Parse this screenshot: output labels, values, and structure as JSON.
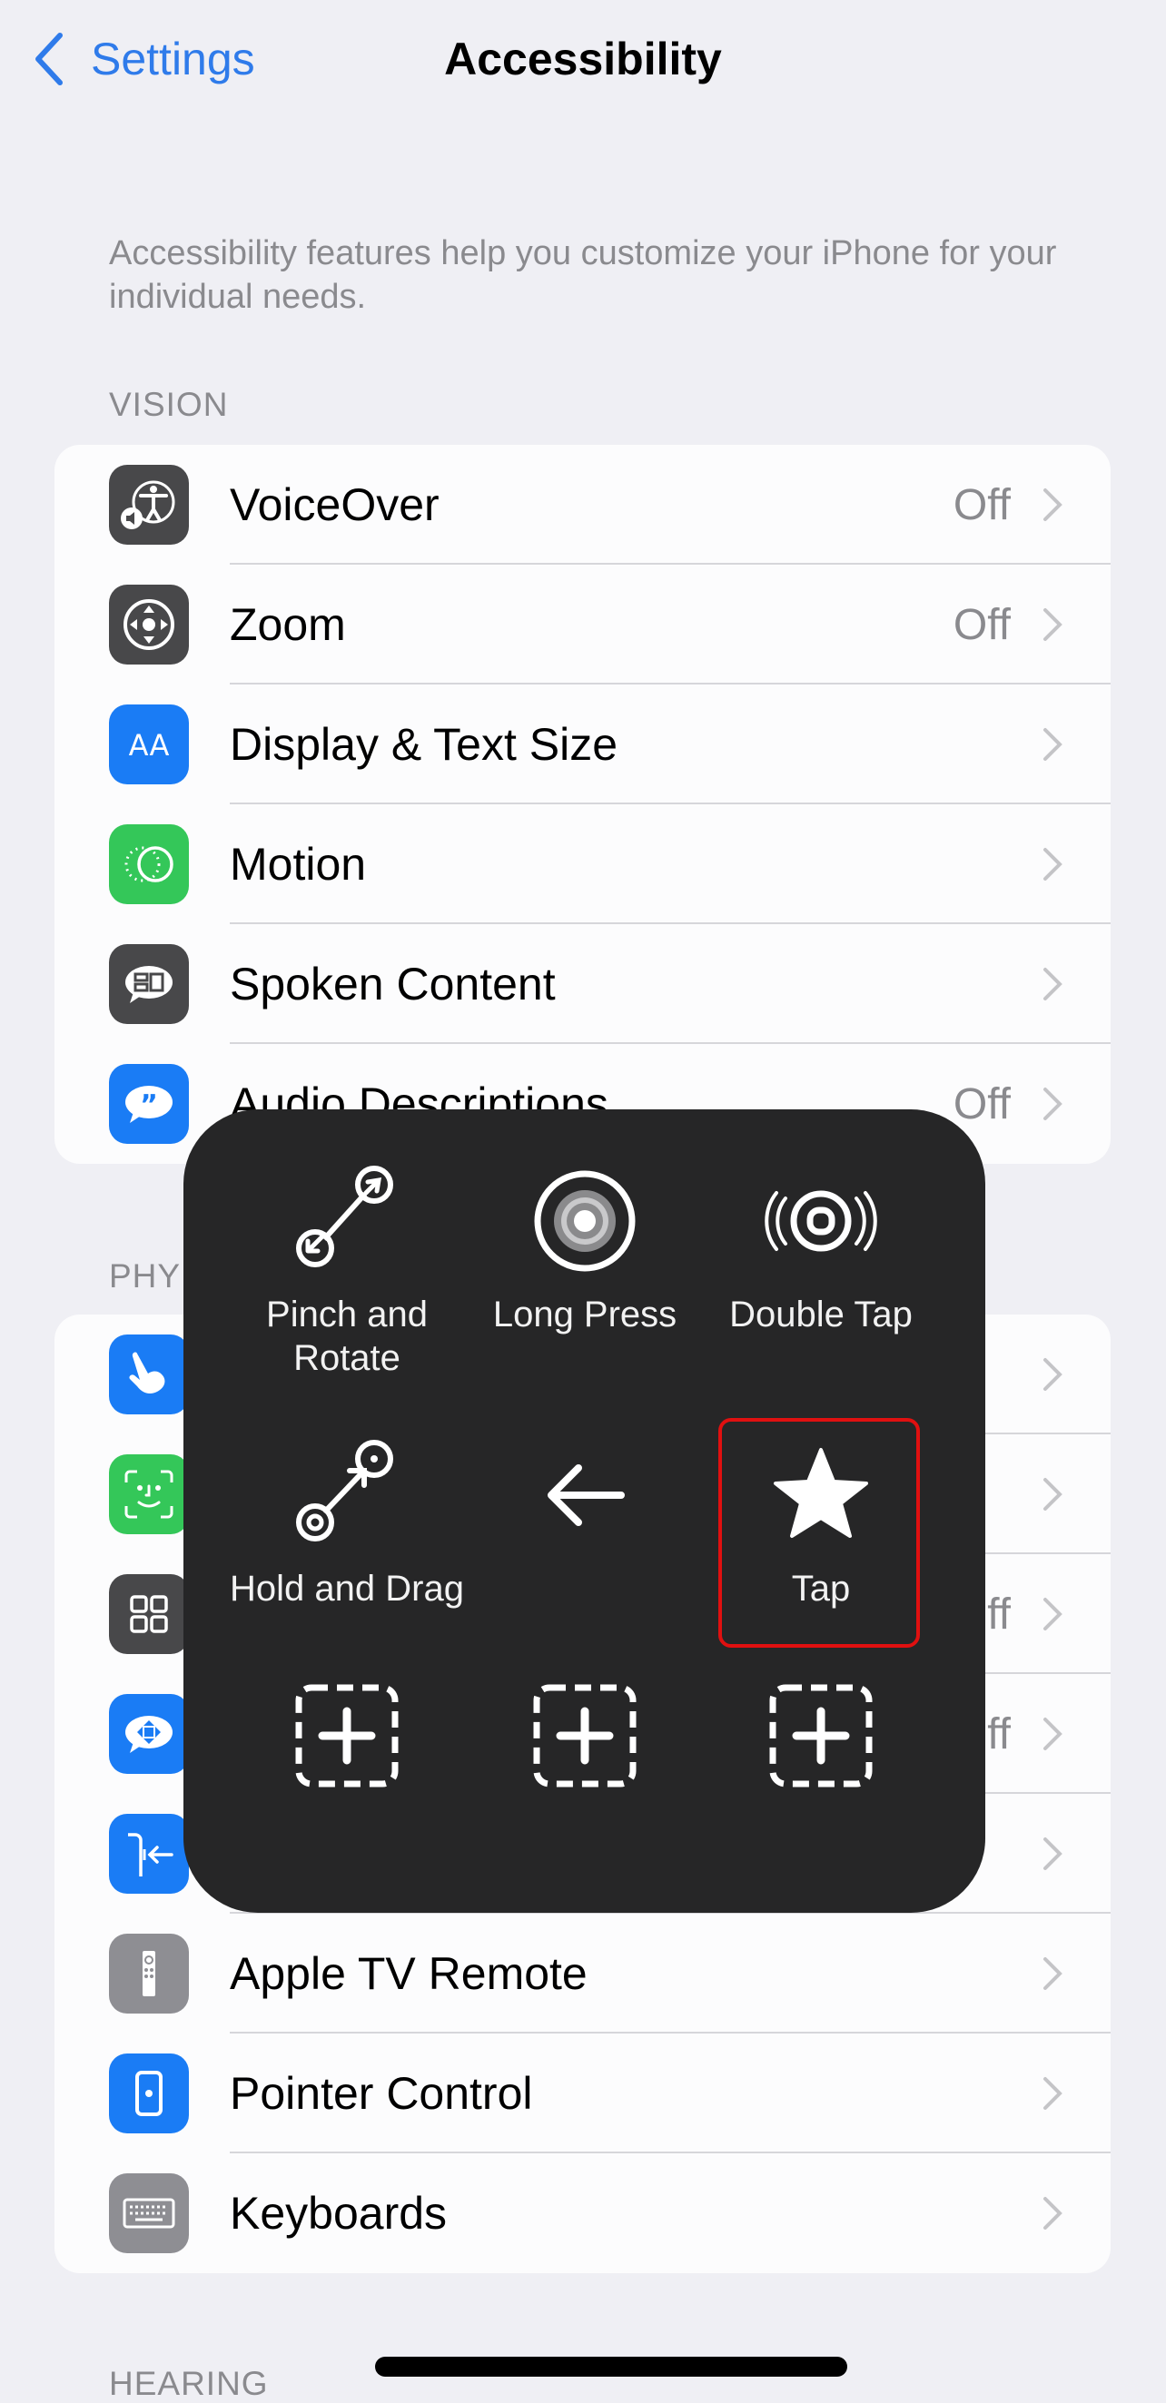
{
  "nav": {
    "back_label": "Settings",
    "title": "Accessibility"
  },
  "description": "Accessibility features help you customize your iPhone for your individual needs.",
  "sections": {
    "vision": {
      "header": "VISION",
      "items": [
        {
          "label": "VoiceOver",
          "value": "Off",
          "icon": "voiceover-icon",
          "icon_color": "#48484a"
        },
        {
          "label": "Zoom",
          "value": "Off",
          "icon": "zoom-icon",
          "icon_color": "#48484a"
        },
        {
          "label": "Display & Text Size",
          "value": "",
          "icon": "text-size-icon",
          "icon_color": "#1a7cf5"
        },
        {
          "label": "Motion",
          "value": "",
          "icon": "motion-icon",
          "icon_color": "#34c759"
        },
        {
          "label": "Spoken Content",
          "value": "",
          "icon": "spoken-content-icon",
          "icon_color": "#48484a"
        },
        {
          "label": "Audio Descriptions",
          "value": "Off",
          "icon": "audio-descriptions-icon",
          "icon_color": "#1a7cf5"
        }
      ]
    },
    "physical": {
      "header": "PHY",
      "items": [
        {
          "label": "",
          "value": "",
          "icon": "touch-icon",
          "icon_color": "#1a7cf5"
        },
        {
          "label": "",
          "value": "",
          "icon": "face-id-icon",
          "icon_color": "#34c759"
        },
        {
          "label": "",
          "value": "ff",
          "icon": "switch-control-icon",
          "icon_color": "#48484a"
        },
        {
          "label": "",
          "value": "ff",
          "icon": "voice-control-icon",
          "icon_color": "#1a7cf5"
        },
        {
          "label": "",
          "value": "",
          "icon": "side-button-icon",
          "icon_color": "#1a7cf5"
        },
        {
          "label": "Apple TV Remote",
          "value": "",
          "icon": "tv-remote-icon",
          "icon_color": "#8e8e93"
        },
        {
          "label": "Pointer Control",
          "value": "",
          "icon": "pointer-control-icon",
          "icon_color": "#1a7cf5"
        },
        {
          "label": "Keyboards",
          "value": "",
          "icon": "keyboard-icon",
          "icon_color": "#8e8e93"
        }
      ]
    },
    "hearing": {
      "header": "HEARING"
    }
  },
  "assistive_menu": {
    "items": [
      {
        "label": "Pinch and Rotate",
        "icon": "pinch-rotate-icon"
      },
      {
        "label": "Long Press",
        "icon": "long-press-icon"
      },
      {
        "label": "Double Tap",
        "icon": "double-tap-icon"
      },
      {
        "label": "Hold and Drag",
        "icon": "hold-drag-icon"
      },
      {
        "label": "",
        "icon": "back-arrow-icon"
      },
      {
        "label": "Tap",
        "icon": "star-icon",
        "highlighted": true
      },
      {
        "label": "",
        "icon": "add-icon"
      },
      {
        "label": "",
        "icon": "add-icon"
      },
      {
        "label": "",
        "icon": "add-icon"
      }
    ],
    "highlight_color": "#e01010"
  },
  "colors": {
    "accent": "#2f7bea",
    "background": "#efeff4"
  }
}
